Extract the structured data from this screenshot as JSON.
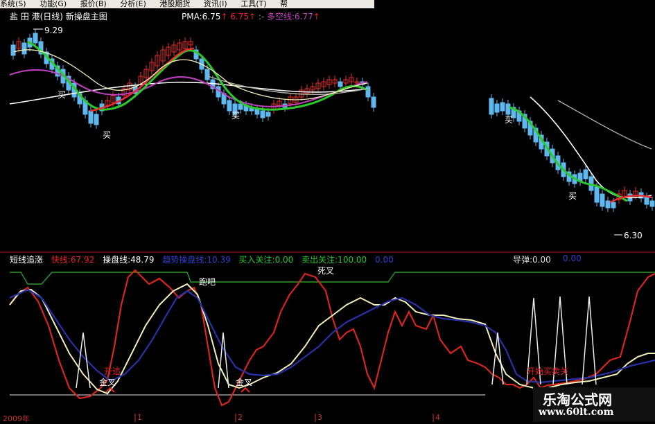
{
  "menu": [
    "系统(S)",
    "功能(G)",
    "报价(B)",
    "分析(E)",
    "港股期货",
    "资讯(I)",
    "工具(T)",
    "帮"
  ],
  "chart_title": "盐 田 港(日线) 新操盘主图",
  "pma": {
    "label": "PMA:6.75",
    "v1": "6.75",
    "v2": "多空线:6.77"
  },
  "price_high": "9.29",
  "price_low": "6.30",
  "buy_label": "买",
  "indicator": {
    "name": "短线追涨",
    "fast": "快线:67.92",
    "op": "操盘线:48.79",
    "trend": "趋势操盘线:10.39",
    "buy_focus": "买入关注:0.00",
    "sell_focus": "卖出关注:100.00",
    "zero": "0.00",
    "rebound": "导弹:0.00",
    "rebound_val": "0.00"
  },
  "annotations": {
    "run": "跑吧",
    "dead_cross": "死叉",
    "gold1": "金叉",
    "gold2": "金叉",
    "hot": "开追",
    "xuanjue": "开始买卖关"
  },
  "dates": [
    "2009年",
    "1",
    "2",
    "3",
    "4"
  ],
  "watermark": {
    "line1": "乐淘公式网",
    "line2": "www.60lt.com"
  },
  "colors": {
    "bg": "#000000",
    "fast": "#d9261c",
    "op": "#f4efb7",
    "trend": "#2632a8",
    "up": "#e82e2e",
    "down": "#5fb8f0",
    "ma_green": "#2bc92b",
    "ma_white": "#ffffff",
    "ma_magenta": "#c040c0"
  }
}
